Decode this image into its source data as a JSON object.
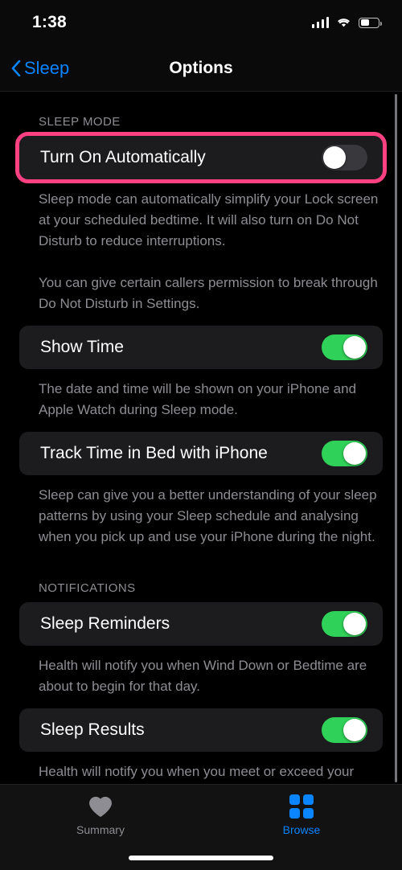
{
  "status_bar": {
    "time": "1:38",
    "signal_icon": "cellular-bars-icon",
    "wifi_icon": "wifi-icon",
    "battery_icon": "battery-icon",
    "battery_level_percent": 52
  },
  "nav_bar": {
    "back_label": "Sleep",
    "back_icon": "chevron-left-icon",
    "title": "Options"
  },
  "sections": [
    {
      "header": "SLEEP MODE",
      "rows": [
        {
          "label": "Turn On Automatically",
          "toggle": "off",
          "highlighted": true,
          "footer": "Sleep mode can automatically simplify your Lock screen at your scheduled bedtime. It will also turn on Do Not Disturb to reduce interruptions.\n\nYou can give certain callers permission to break through Do Not Disturb in Settings."
        },
        {
          "label": "Show Time",
          "toggle": "on",
          "highlighted": false,
          "footer": "The date and time will be shown on your iPhone and Apple Watch during Sleep mode."
        },
        {
          "label": "Track Time in Bed with iPhone",
          "toggle": "on",
          "highlighted": false,
          "footer": "Sleep can give you a better understanding of your sleep patterns by using your Sleep schedule and analysing when you pick up and use your iPhone during the night."
        }
      ]
    },
    {
      "header": "NOTIFICATIONS",
      "rows": [
        {
          "label": "Sleep Reminders",
          "toggle": "on",
          "highlighted": false,
          "footer": "Health will notify you when Wind Down or Bedtime are about to begin for that day."
        },
        {
          "label": "Sleep Results",
          "toggle": "on",
          "highlighted": false,
          "footer": "Health will notify you when you meet or exceed your"
        }
      ]
    }
  ],
  "tab_bar": {
    "tabs": [
      {
        "label": "Summary",
        "icon": "heart-icon",
        "active": false
      },
      {
        "label": "Browse",
        "icon": "grid-squares-icon",
        "active": true
      }
    ]
  },
  "colors": {
    "accent_blue": "#0a84ff",
    "toggle_on_green": "#30d158",
    "toggle_off_gray": "#39393d",
    "highlight_pink": "#ff4081",
    "row_background": "#1c1c1e",
    "page_background": "#000000",
    "secondary_text": "#8d8d93"
  }
}
